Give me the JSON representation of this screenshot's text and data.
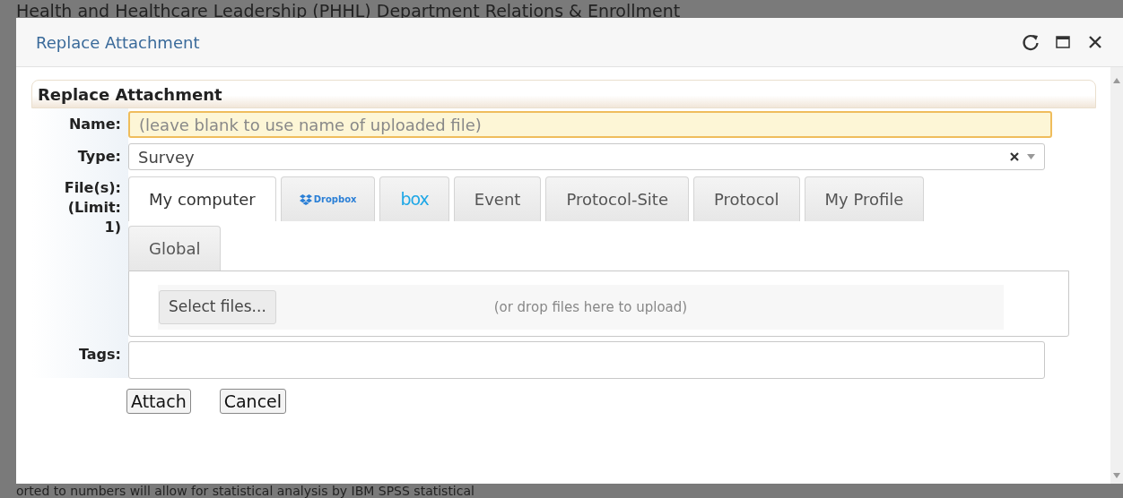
{
  "background": {
    "top_line": "Health and Healthcare Leadership (PHHL) Department Relations & Enrollment",
    "bottom_line": "orted to numbers will allow for statistical analysis by IBM SPSS statistical"
  },
  "window": {
    "title": "Replace Attachment"
  },
  "section_title": "Replace Attachment",
  "fields": [
    {
      "kind": "text",
      "label": "Name:",
      "placeholder": "(leave blank to use name of uploaded file)",
      "focused": true
    },
    {
      "kind": "select",
      "label": "Type:",
      "value": "Survey"
    }
  ],
  "files": {
    "label_lines": [
      "File(s):",
      "(Limit:",
      "1)"
    ],
    "tabs": [
      {
        "kind": "text",
        "label": "My computer",
        "selected": true
      },
      {
        "kind": "dropbox",
        "label": "Dropbox",
        "selected": false
      },
      {
        "kind": "box",
        "label": "box",
        "selected": false
      },
      {
        "kind": "text",
        "label": "Event",
        "selected": false
      },
      {
        "kind": "text",
        "label": "Protocol-Site",
        "selected": false
      },
      {
        "kind": "text",
        "label": "Protocol",
        "selected": false
      },
      {
        "kind": "text",
        "label": "My Profile",
        "selected": false
      },
      {
        "kind": "text",
        "label": "Global",
        "selected": false
      }
    ],
    "select_button": "Select files...",
    "drop_hint": "(or drop files here to upload)"
  },
  "tags": {
    "label": "Tags:"
  },
  "buttons": [
    "Attach",
    "Cancel"
  ]
}
